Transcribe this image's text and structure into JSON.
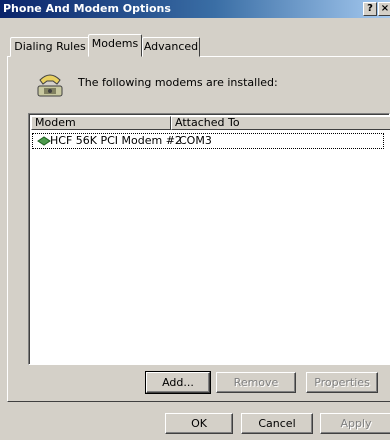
{
  "window": {
    "title": "Phone And Modem Options",
    "help_glyph": "?",
    "close_glyph": "×"
  },
  "tabs": [
    {
      "label": "Dialing Rules"
    },
    {
      "label": "Modems",
      "selected": true
    },
    {
      "label": "Advanced"
    }
  ],
  "modems_tab": {
    "intro_text": "The following modems are installed:",
    "columns": [
      "Modem",
      "Attached To"
    ],
    "rows": [
      {
        "modem": "HCF 56K PCI Modem #2",
        "attached_to": "COM3",
        "icon": "modem-icon"
      }
    ],
    "buttons": {
      "add": "Add...",
      "remove": "Remove",
      "properties": "Properties"
    }
  },
  "footer": {
    "ok": "OK",
    "cancel": "Cancel",
    "apply": "Apply"
  },
  "colors": {
    "face": "#d4d0c8",
    "title_start": "#0a246a",
    "title_end": "#a6caf0"
  }
}
